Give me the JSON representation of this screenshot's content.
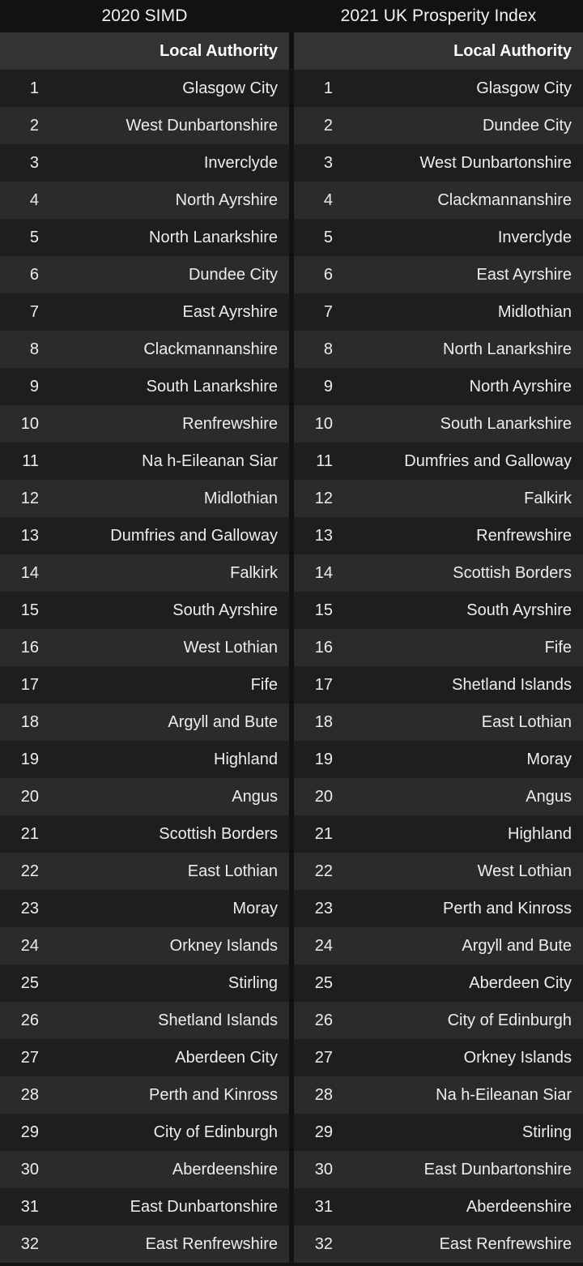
{
  "page": {
    "background_color": "#121212",
    "row_color_odd": "#1e1e1e",
    "row_color_even": "#2b2b2b",
    "header_band_color": "#333333",
    "text_color": "#ededed"
  },
  "tables": [
    {
      "title": "2020 SIMD",
      "columns": {
        "rank": "",
        "name": "Local Authority"
      },
      "rows": [
        {
          "rank": "1",
          "name": "Glasgow City"
        },
        {
          "rank": "2",
          "name": "West Dunbartonshire"
        },
        {
          "rank": "3",
          "name": "Inverclyde"
        },
        {
          "rank": "4",
          "name": "North Ayrshire"
        },
        {
          "rank": "5",
          "name": "North Lanarkshire"
        },
        {
          "rank": "6",
          "name": "Dundee City"
        },
        {
          "rank": "7",
          "name": "East Ayrshire"
        },
        {
          "rank": "8",
          "name": "Clackmannanshire"
        },
        {
          "rank": "9",
          "name": "South Lanarkshire"
        },
        {
          "rank": "10",
          "name": "Renfrewshire"
        },
        {
          "rank": "11",
          "name": "Na h-Eileanan Siar"
        },
        {
          "rank": "12",
          "name": "Midlothian"
        },
        {
          "rank": "13",
          "name": "Dumfries and Galloway"
        },
        {
          "rank": "14",
          "name": "Falkirk"
        },
        {
          "rank": "15",
          "name": "South Ayrshire"
        },
        {
          "rank": "16",
          "name": "West Lothian"
        },
        {
          "rank": "17",
          "name": "Fife"
        },
        {
          "rank": "18",
          "name": "Argyll and Bute"
        },
        {
          "rank": "19",
          "name": "Highland"
        },
        {
          "rank": "20",
          "name": "Angus"
        },
        {
          "rank": "21",
          "name": "Scottish Borders"
        },
        {
          "rank": "22",
          "name": "East Lothian"
        },
        {
          "rank": "23",
          "name": "Moray"
        },
        {
          "rank": "24",
          "name": "Orkney Islands"
        },
        {
          "rank": "25",
          "name": "Stirling"
        },
        {
          "rank": "26",
          "name": "Shetland Islands"
        },
        {
          "rank": "27",
          "name": "Aberdeen City"
        },
        {
          "rank": "28",
          "name": "Perth and Kinross"
        },
        {
          "rank": "29",
          "name": "City of Edinburgh"
        },
        {
          "rank": "30",
          "name": "Aberdeenshire"
        },
        {
          "rank": "31",
          "name": "East Dunbartonshire"
        },
        {
          "rank": "32",
          "name": "East Renfrewshire"
        }
      ]
    },
    {
      "title": "2021 UK Prosperity Index",
      "columns": {
        "rank": "",
        "name": "Local Authority"
      },
      "rows": [
        {
          "rank": "1",
          "name": "Glasgow City"
        },
        {
          "rank": "2",
          "name": "Dundee City"
        },
        {
          "rank": "3",
          "name": "West Dunbartonshire"
        },
        {
          "rank": "4",
          "name": "Clackmannanshire"
        },
        {
          "rank": "5",
          "name": "Inverclyde"
        },
        {
          "rank": "6",
          "name": "East Ayrshire"
        },
        {
          "rank": "7",
          "name": "Midlothian"
        },
        {
          "rank": "8",
          "name": "North Lanarkshire"
        },
        {
          "rank": "9",
          "name": "North Ayrshire"
        },
        {
          "rank": "10",
          "name": "South Lanarkshire"
        },
        {
          "rank": "11",
          "name": "Dumfries and Galloway"
        },
        {
          "rank": "12",
          "name": "Falkirk"
        },
        {
          "rank": "13",
          "name": "Renfrewshire"
        },
        {
          "rank": "14",
          "name": "Scottish Borders"
        },
        {
          "rank": "15",
          "name": "South Ayrshire"
        },
        {
          "rank": "16",
          "name": "Fife"
        },
        {
          "rank": "17",
          "name": "Shetland Islands"
        },
        {
          "rank": "18",
          "name": "East Lothian"
        },
        {
          "rank": "19",
          "name": "Moray"
        },
        {
          "rank": "20",
          "name": "Angus"
        },
        {
          "rank": "21",
          "name": "Highland"
        },
        {
          "rank": "22",
          "name": "West Lothian"
        },
        {
          "rank": "23",
          "name": "Perth and Kinross"
        },
        {
          "rank": "24",
          "name": "Argyll and Bute"
        },
        {
          "rank": "25",
          "name": "Aberdeen City"
        },
        {
          "rank": "26",
          "name": "City of Edinburgh"
        },
        {
          "rank": "27",
          "name": "Orkney Islands"
        },
        {
          "rank": "28",
          "name": "Na h-Eileanan Siar"
        },
        {
          "rank": "29",
          "name": "Stirling"
        },
        {
          "rank": "30",
          "name": "East Dunbartonshire"
        },
        {
          "rank": "31",
          "name": "Aberdeenshire"
        },
        {
          "rank": "32",
          "name": "East Renfrewshire"
        }
      ]
    }
  ]
}
